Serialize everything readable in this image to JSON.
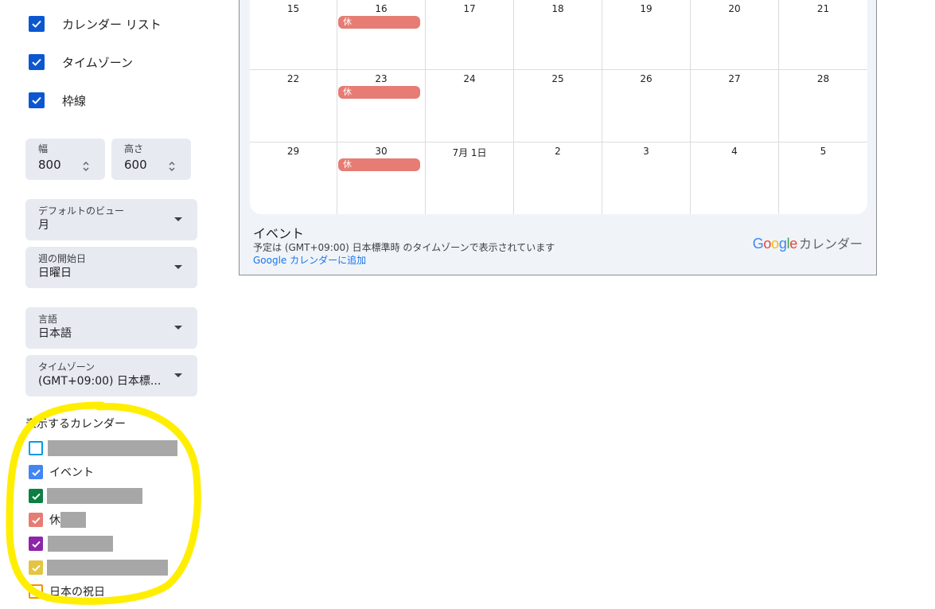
{
  "options": [
    {
      "label": "カレンダー リスト",
      "checked": true
    },
    {
      "label": "タイムゾーン",
      "checked": true
    },
    {
      "label": "枠線",
      "checked": true
    }
  ],
  "size": {
    "width_label": "幅",
    "width_value": "800",
    "height_label": "高さ",
    "height_value": "600"
  },
  "selects": {
    "default_view": {
      "label": "デフォルトのビュー",
      "value": "月"
    },
    "week_start": {
      "label": "週の開始日",
      "value": "日曜日"
    },
    "language": {
      "label": "言語",
      "value": "日本語"
    },
    "timezone": {
      "label": "タイムゾーン",
      "value": "(GMT+09:00) 日本標..."
    }
  },
  "calendars_section": {
    "title": "表示するカレンダー",
    "items": [
      {
        "name": "",
        "redacted": true,
        "checked": false,
        "color": "#039be5"
      },
      {
        "name": "イベント",
        "redacted": false,
        "checked": true,
        "color": "#4285f4"
      },
      {
        "name": "",
        "redacted": true,
        "checked": true,
        "color": "#0b8043"
      },
      {
        "name": "休",
        "redacted": true,
        "checked": true,
        "color": "#e67c73"
      },
      {
        "name": "",
        "redacted": true,
        "checked": true,
        "color": "#8e24aa"
      },
      {
        "name": "",
        "redacted": true,
        "checked": true,
        "color": "#e4c441"
      },
      {
        "name": "日本の祝日",
        "redacted": false,
        "checked": false,
        "color": "#f09300"
      }
    ]
  },
  "calendar_grid": {
    "weeks": [
      [
        "15",
        "16",
        "17",
        "18",
        "19",
        "20",
        "21"
      ],
      [
        "22",
        "23",
        "24",
        "25",
        "26",
        "27",
        "28"
      ],
      [
        "29",
        "30",
        "7月 1日",
        "2",
        "3",
        "4",
        "5"
      ]
    ],
    "events": [
      {
        "week": 0,
        "day": 1,
        "title": "休"
      },
      {
        "week": 1,
        "day": 1,
        "title": "休"
      },
      {
        "week": 2,
        "day": 1,
        "title": "休"
      }
    ],
    "event_color": "#e67c73"
  },
  "embed_footer": {
    "title": "イベント",
    "timezone_note": "予定は (GMT+09:00) 日本標準時 のタイムゾーンで表示されています",
    "add_link": "Google カレンダーに追加",
    "brand_google": "Google",
    "brand_suffix": "カレンダー"
  },
  "colors": {
    "accent_blue": "#0b57d0",
    "highlight": "#ffee00"
  }
}
